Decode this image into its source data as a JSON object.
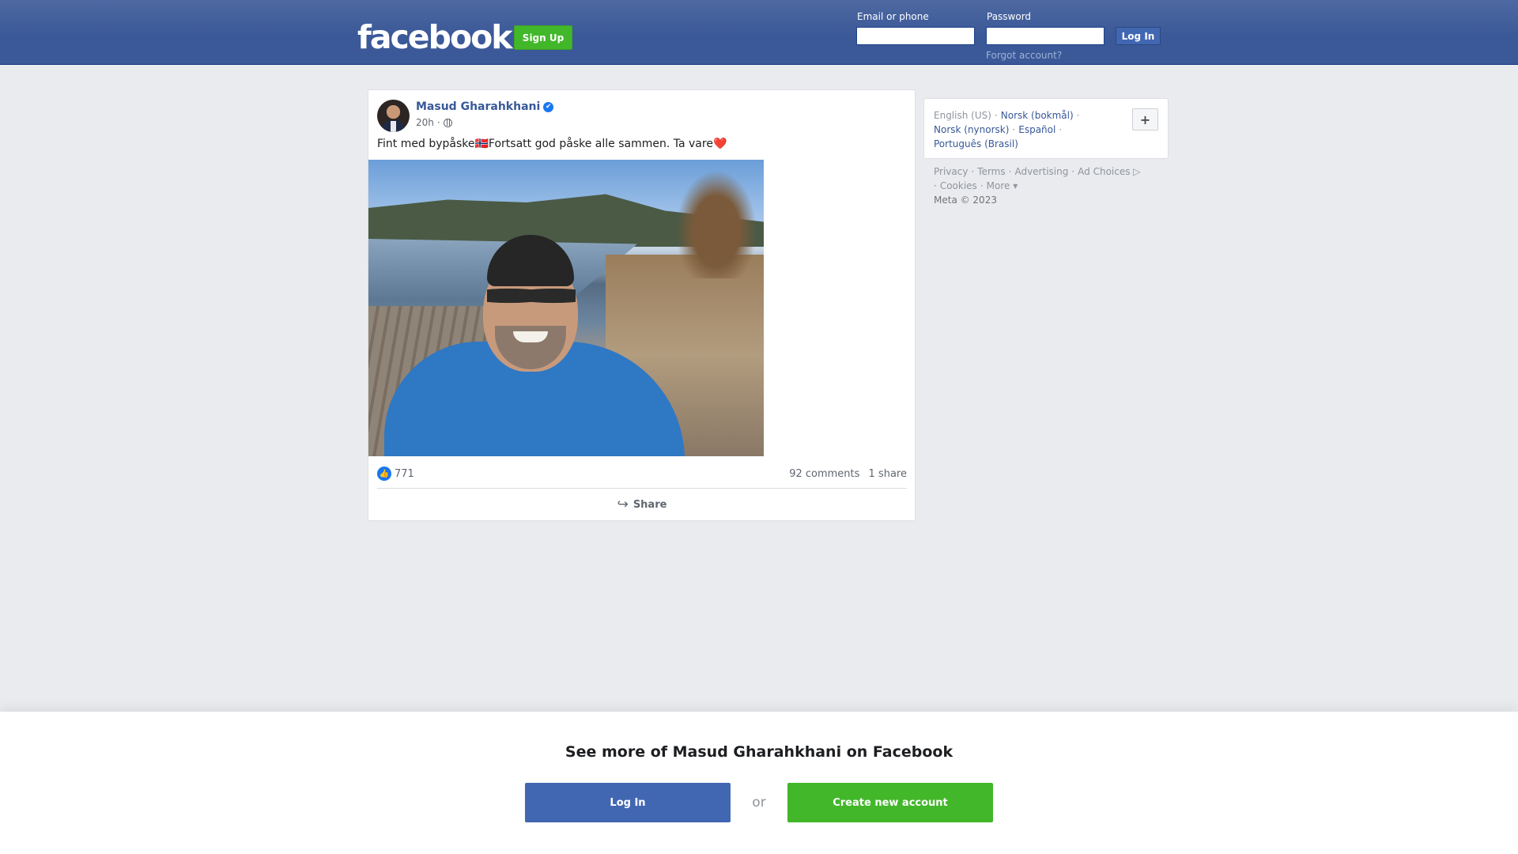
{
  "header": {
    "logo_text": "facebook",
    "signup_label": "Sign Up",
    "email_label": "Email or phone",
    "email_value": "",
    "password_label": "Password",
    "password_value": "",
    "login_label": "Log In",
    "forgot_label": "Forgot account?"
  },
  "post": {
    "author": "Masud Gharahkhani",
    "verified_icon": "✔",
    "time": "20h",
    "separator": "·",
    "visibility_icon": "globe-icon",
    "text": "Fint med bypåske🇳🇴Fortsatt god påske alle sammen. Ta vare❤️",
    "photo_alt": "photo",
    "like_icon": "👍",
    "like_count": "771",
    "comments": "92 comments",
    "shares": "1 share",
    "share_icon": "↪",
    "share_label": "Share"
  },
  "languages": {
    "current": "English (US)",
    "others": [
      "Norsk (bokmål)",
      "Norsk (nynorsk)",
      "Español",
      "Português (Brasil)"
    ],
    "separator": "·",
    "plus_label": "+"
  },
  "footer": {
    "links": [
      "Privacy",
      "Terms",
      "Advertising",
      "Ad Choices ▷",
      "Cookies",
      "More ▾"
    ],
    "separator": "·",
    "copyright": "Meta © 2023"
  },
  "banner": {
    "title": "See more of Masud Gharahkhani on Facebook",
    "login_label": "Log In",
    "or_label": "or",
    "create_label": "Create new account"
  },
  "colors": {
    "brand_blue": "#3b5998",
    "button_blue": "#4267b2",
    "green": "#42b72a",
    "link": "#385898"
  }
}
